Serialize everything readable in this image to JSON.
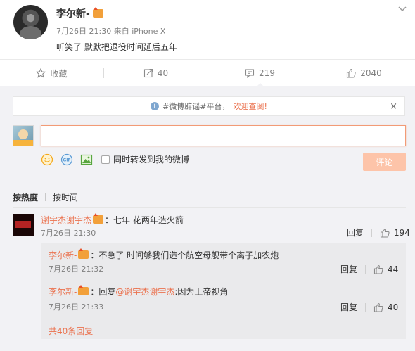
{
  "post": {
    "author": "李尔新-",
    "time": "7月26日 21:30",
    "source_prefix": "来自",
    "source": "iPhone X",
    "text": "听笑了 默默把退役时间延后五年"
  },
  "actions": {
    "favorite_label": "收藏",
    "repost_count": "40",
    "comment_count": "219",
    "like_count": "2040"
  },
  "notice": {
    "prefix": "#微博辟谣#平台，",
    "link": "欢迎查阅!",
    "close": "×"
  },
  "composer": {
    "input_value": "",
    "repost_label": "同时转发到我的微博",
    "submit_label": "评论"
  },
  "sort": {
    "by_hot": "按热度",
    "by_time": "按时间"
  },
  "comment": {
    "author": "谢宇杰谢宇杰",
    "text": "：七年 花两年造火箭",
    "time": "7月26日 21:30",
    "reply_label": "回复",
    "likes": "194"
  },
  "replies": [
    {
      "author": "李尔新-",
      "text": "：不急了 时间够我们造个航空母舰带个离子加农炮",
      "time": "7月26日 21:32",
      "reply_label": "回复",
      "likes": "44"
    },
    {
      "author": "李尔新-",
      "prefix": "：回复",
      "mention": "@谢宇杰谢宇杰",
      "text": ":因为上帝视角",
      "time": "7月26日 21:33",
      "reply_label": "回复",
      "likes": "40"
    }
  ],
  "more_replies": "共40条回复",
  "colors": {
    "accent": "#eb7350",
    "panel_bg": "#f2f2f5",
    "sub_bg": "#eaeaec",
    "submit_disabled": "#fdc4a9"
  }
}
